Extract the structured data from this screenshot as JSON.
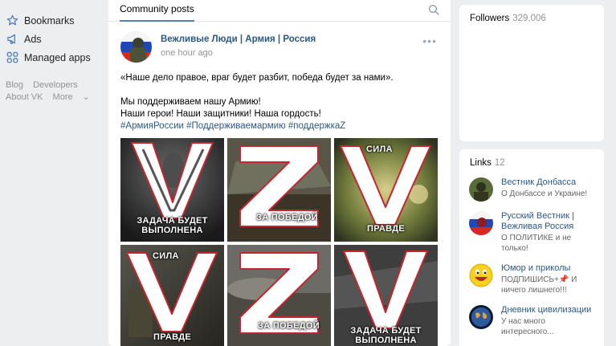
{
  "sidebar": {
    "items": [
      {
        "label": "Bookmarks",
        "icon": "star-icon"
      },
      {
        "label": "Ads",
        "icon": "megaphone-icon"
      },
      {
        "label": "Managed apps",
        "icon": "apps-grid-icon"
      }
    ],
    "footer": [
      "Blog",
      "Developers",
      "About VK",
      "More"
    ]
  },
  "feed": {
    "tab": "Community posts",
    "post": {
      "author": "Вежливые Люди | Армия | Россия",
      "time": "one hour ago",
      "text1": "«Наше дело правое, враг будет разбит, победа будет за нами».",
      "text2": "Мы поддерживаем нашу Армию!",
      "text3": "Наши герои! Наши защитники! Наша гордость!",
      "hashtags": [
        "#АрмияРоссии",
        "#Поддерживаемармию",
        "#поддержкаZ"
      ],
      "images": [
        {
          "letter": "V",
          "caption": "ЗАДАЧА БУДЕТ ВЫПОЛНЕНА"
        },
        {
          "letter": "Z",
          "caption": "ЗА ПОБЕДОЙ"
        },
        {
          "letter": "V",
          "caption_top": "СИЛА",
          "caption": "ПРАВДЕ"
        },
        {
          "letter": "V",
          "caption_top": "СИЛА",
          "caption": "ПРАВДЕ"
        },
        {
          "letter": "Z",
          "caption": "ЗА ПОБЕДОЙ"
        },
        {
          "letter": "V",
          "caption": "ЗАДАЧА БУДЕТ ВЫПОЛНЕНА"
        }
      ]
    }
  },
  "followers": {
    "label": "Followers",
    "count": "329,006"
  },
  "links": {
    "label": "Links",
    "count": "12",
    "items": [
      {
        "name": "Вестник Донбасса",
        "desc": "О Донбассе и Украине!",
        "color": "#5a6b3a"
      },
      {
        "name": "Русский Вестник | Вежливая Россия",
        "desc": "О ПОЛИТИКЕ и не только!",
        "color": "#c8202a"
      },
      {
        "name": "Юмор и приколы",
        "desc": "ПОДПИШИСЬ+📌 И ничего лишнего!!!",
        "color": "#f2c41a"
      },
      {
        "name": "Дневник цивилизации",
        "desc": "У нас много интересного...",
        "color": "#2f5a9c"
      }
    ]
  }
}
